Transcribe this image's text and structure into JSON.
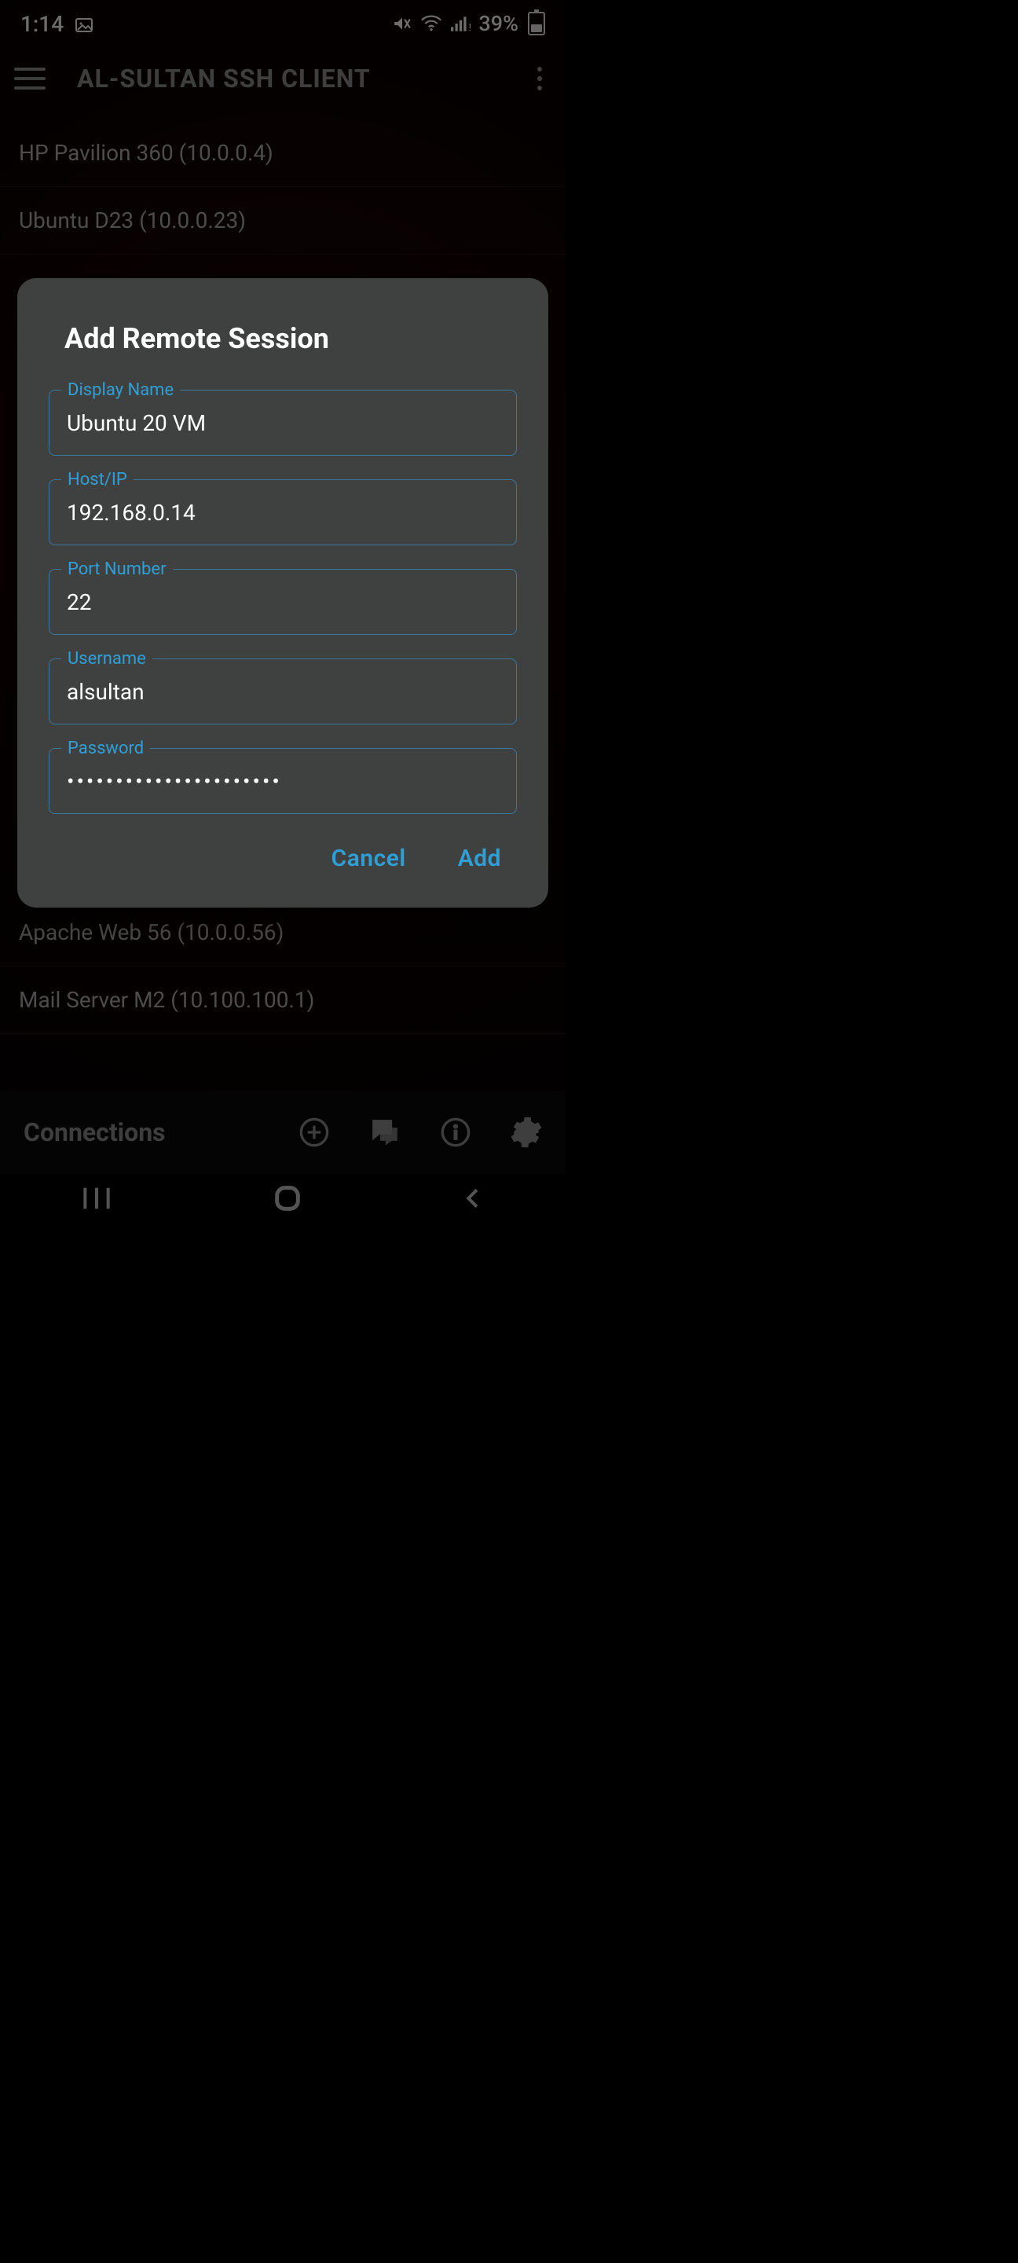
{
  "statusbar": {
    "time": "1:14",
    "battery_pct": "39%"
  },
  "appbar": {
    "title": "AL-SULTAN SSH CLIENT"
  },
  "connections": [
    "HP Pavilion 360 (10.0.0.4)",
    "Ubuntu D23 (10.0.0.23)",
    "Apache Web 56 (10.0.0.56)",
    "Mail Server M2 (10.100.100.1)"
  ],
  "bottom": {
    "label": "Connections"
  },
  "dialog": {
    "title": "Add Remote Session",
    "fields": {
      "display_name": {
        "label": "Display Name",
        "value": "Ubuntu 20 VM"
      },
      "host": {
        "label": "Host/IP",
        "value": "192.168.0.14"
      },
      "port": {
        "label": "Port Number",
        "value": "22"
      },
      "user": {
        "label": "Username",
        "value": "alsultan"
      },
      "password": {
        "label": "Password",
        "value": "••••••••••••••••••••••"
      }
    },
    "cancel": "Cancel",
    "add": "Add"
  }
}
